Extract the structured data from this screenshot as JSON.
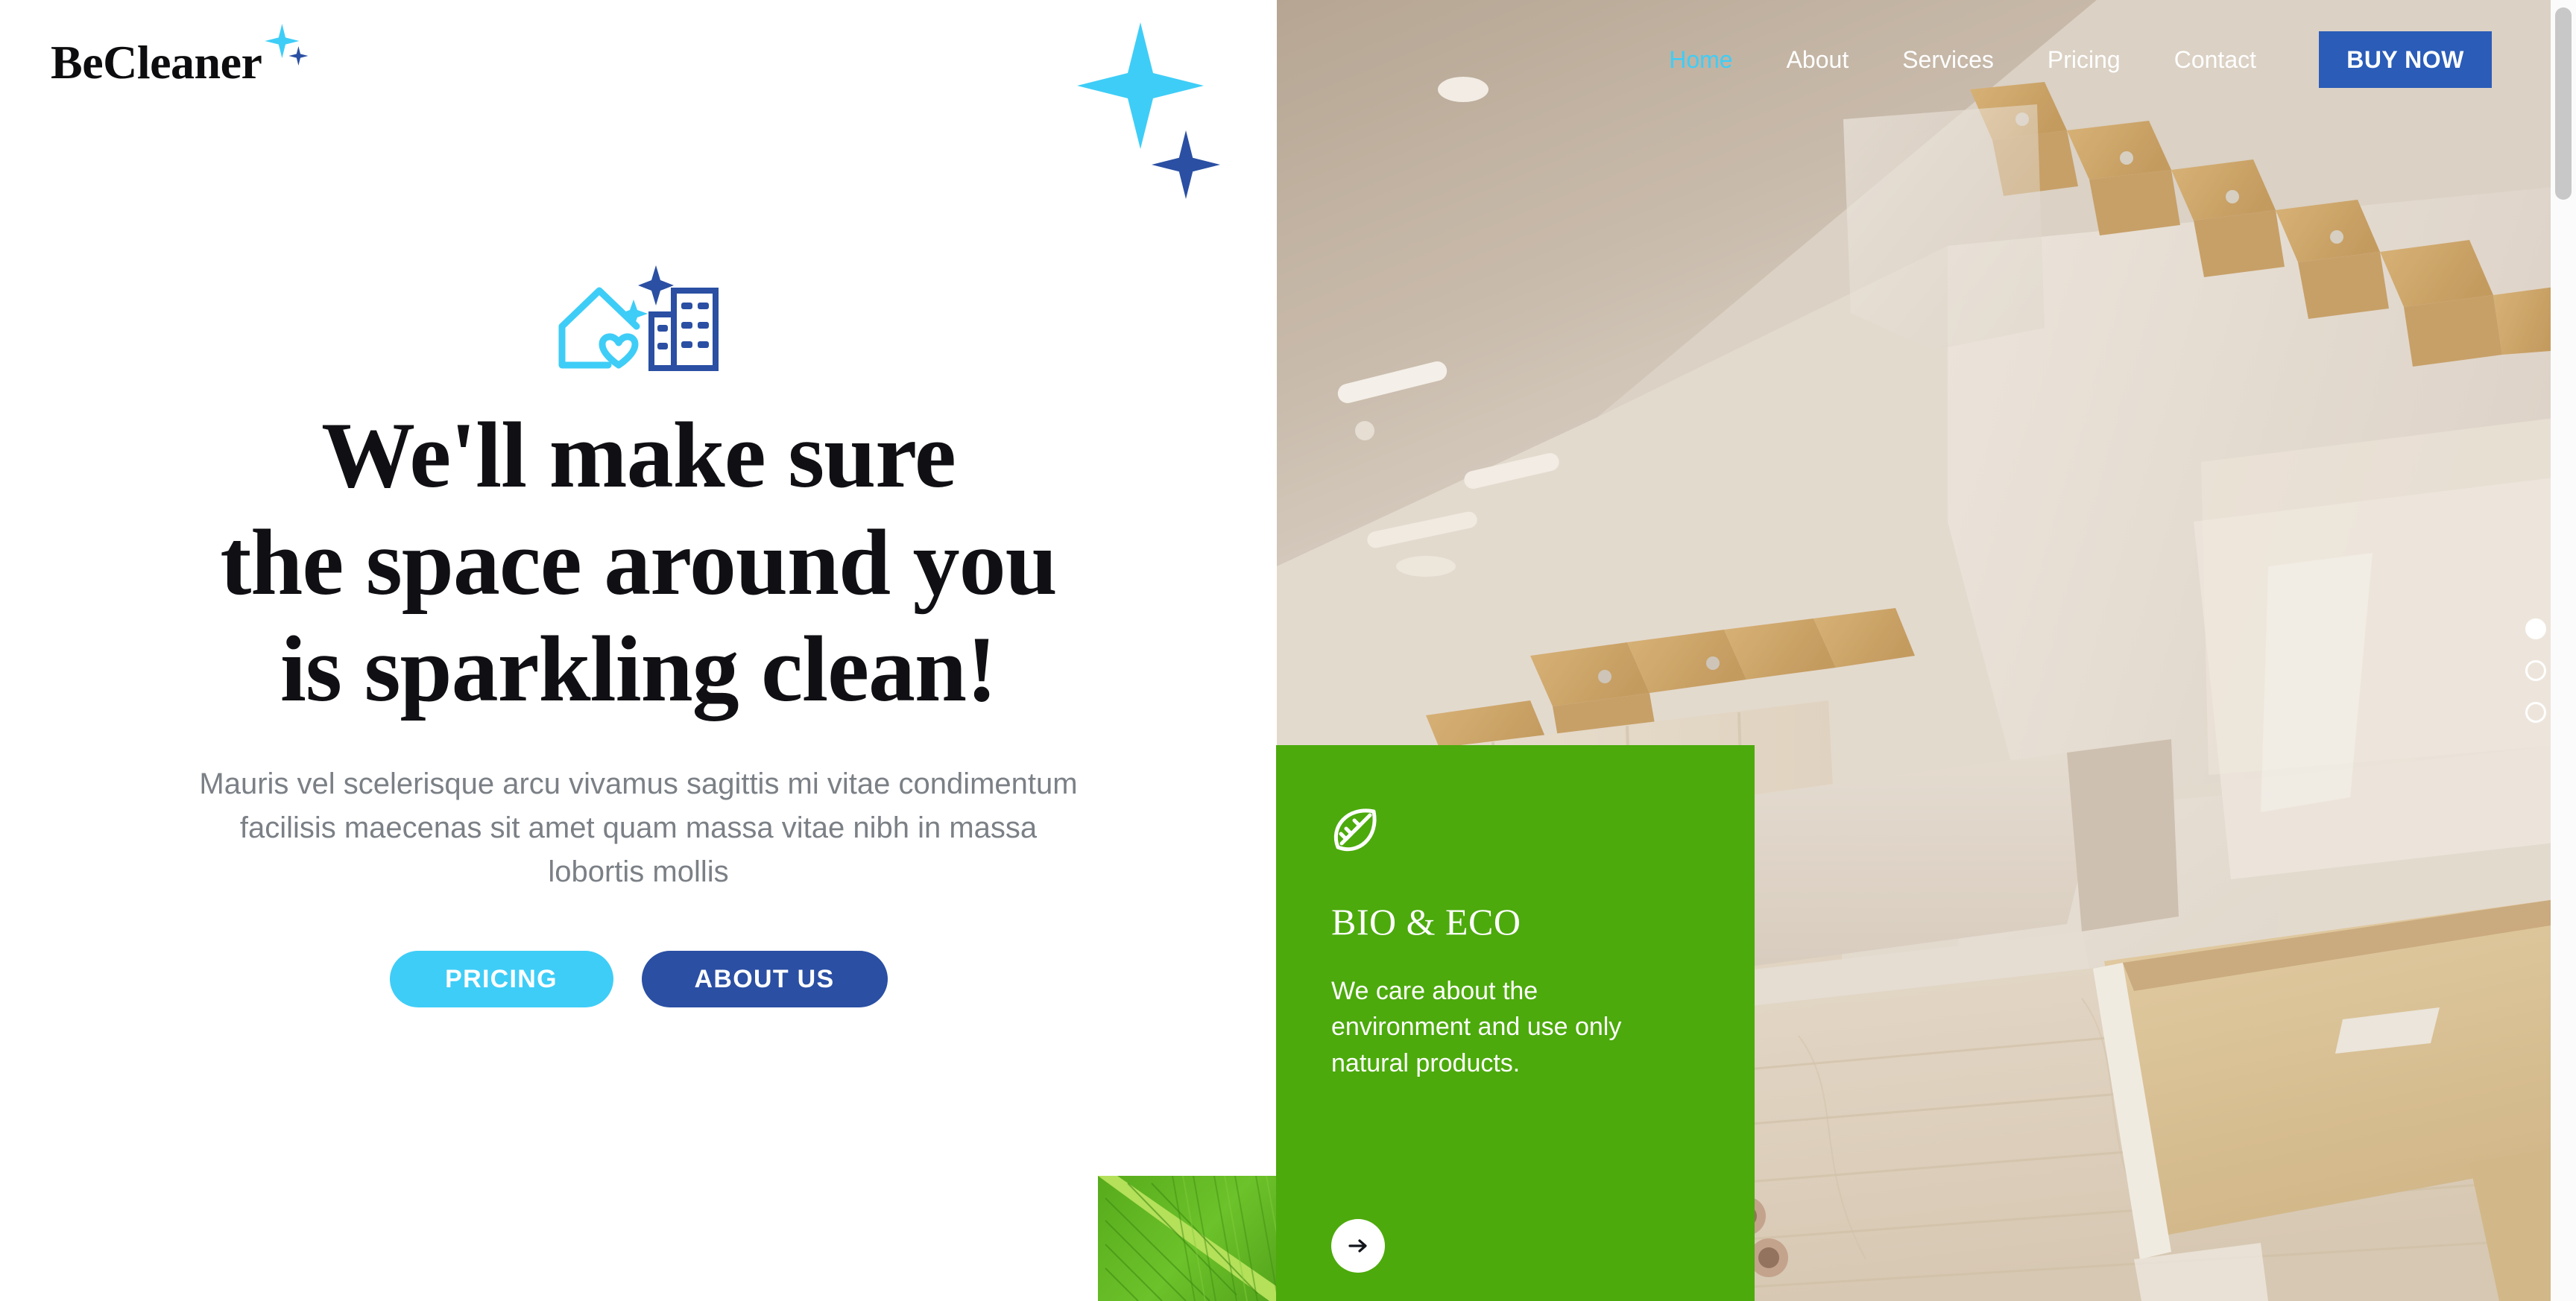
{
  "brand": {
    "name": "BeCleaner",
    "sparkle_large_color": "#3ecdf7",
    "sparkle_small_color": "#2a4fa3"
  },
  "nav": {
    "links": [
      {
        "label": "Home",
        "active": true
      },
      {
        "label": "About",
        "active": false
      },
      {
        "label": "Services",
        "active": false
      },
      {
        "label": "Pricing",
        "active": false
      },
      {
        "label": "Contact",
        "active": false
      }
    ],
    "cta_label": "BUY NOW",
    "cta_color": "#2a5cb8",
    "active_color": "#3ecdf7"
  },
  "hero": {
    "icon_name": "house-heart-building-sparkle-icon",
    "title_line1": "We'll make sure",
    "title_line2": "the space around you",
    "title_line3": "is sparkling clean!",
    "subtitle": "Mauris vel scelerisque arcu vivamus sagittis mi vitae condimentum facilisis maecenas sit amet quam massa vitae nibh in massa lobortis mollis",
    "primary_button": "PRICING",
    "secondary_button": "ABOUT US",
    "primary_button_color": "#3ecdf7",
    "secondary_button_color": "#2a4fa3"
  },
  "eco_card": {
    "icon_name": "leaf-icon",
    "title": "BIO & ECO",
    "body": "We care about the environment and use only natural products.",
    "background_color": "#4caa0c",
    "arrow_label": "→"
  },
  "carousel": {
    "dots": [
      {
        "active": true
      },
      {
        "active": false
      },
      {
        "active": false
      }
    ]
  },
  "photo": {
    "alt": "modern bright interior with wooden floating staircase, white cabinetry and light wood floor"
  },
  "leaf_photo": {
    "alt": "close-up of a green leaf with veins"
  }
}
